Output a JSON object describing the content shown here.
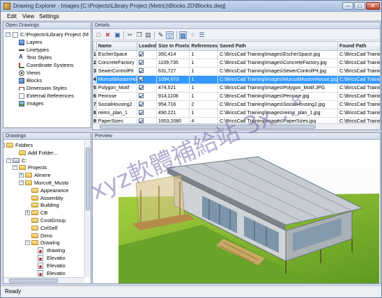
{
  "window": {
    "title": "Drawing Explorer - Images [C:\\Projects\\Library Project (Metric)\\Blocks 2D\\Blocks.dwg]",
    "buttons": {
      "minimize": "–",
      "maximize": "□",
      "close": "✕"
    }
  },
  "menu": {
    "edit": "Edit",
    "view": "View",
    "settings": "Settings"
  },
  "open_drawings": {
    "title": "Open Drawings",
    "root": "C:\\Projects\\Library Project (M",
    "items": [
      {
        "label": "Layers",
        "icon": "layers-icon"
      },
      {
        "label": "Linetypes",
        "icon": "linetypes-icon"
      },
      {
        "label": "Text Styles",
        "icon": "text-styles-icon"
      },
      {
        "label": "Coordinate Systems",
        "icon": "coordinate-systems-icon"
      },
      {
        "label": "Views",
        "icon": "views-icon"
      },
      {
        "label": "Blocks",
        "icon": "blocks-icon"
      },
      {
        "label": "Dimension Styles",
        "icon": "dimension-styles-icon"
      },
      {
        "label": "External References",
        "icon": "external-references-icon"
      },
      {
        "label": "Images",
        "icon": "images-icon"
      }
    ]
  },
  "details": {
    "title": "Details",
    "toolbar": [
      "new-icon",
      "delete-icon",
      "attach-icon",
      "cut-icon",
      "copy-icon",
      "paste-icon",
      "edit-icon",
      "filter-icon",
      "table-view-icon",
      "icon-view-icon",
      "tree-view-icon"
    ],
    "columns": [
      "",
      "Name",
      "Loaded",
      "Size In Pixels",
      "References",
      "Saved Path",
      "Found Path"
    ],
    "rows": [
      {
        "n": "1",
        "name": "EscherSpace",
        "size": "350,414",
        "refs": "1",
        "saved": "C:\\BricsCad Training\\Images\\EscherSpace.jpg",
        "found": "C:\\BricsCad Trainin"
      },
      {
        "n": "2",
        "name": "ConcreteFactory",
        "size": "1109,735",
        "refs": "1",
        "saved": "C:\\BricsCad Training\\Images\\ConcreteFactory.jpg",
        "found": "C:\\BricsCad Trainin"
      },
      {
        "n": "3",
        "name": "SewerControlPit",
        "size": "631,727",
        "refs": "1",
        "saved": "C:\\BricsCad Training\\Images\\SewerControlPit.jpg",
        "found": "C:\\BricsCad Trainin"
      },
      {
        "n": "4",
        "name": "MurcuttMustonHo",
        "size": "1094,673",
        "refs": "1",
        "saved": "C:\\BricsCad Training\\Images\\MurcuttMustonHouse.jpg",
        "found": "C:\\BricsCad Trainin"
      },
      {
        "n": "5",
        "name": "Polygon_Motif",
        "size": "474,521",
        "refs": "1",
        "saved": "C:\\BricsCad Training\\Images\\Polygon_Motif.JPG",
        "found": "C:\\BricsCad Trainin"
      },
      {
        "n": "6",
        "name": "Penrose",
        "size": "914,1108",
        "refs": "1",
        "saved": "C:\\BricsCad Training\\Images\\Penrose.jpg",
        "found": "C:\\BricsCad Trainin"
      },
      {
        "n": "7",
        "name": "SocialHousing2",
        "size": "954,716",
        "refs": "2",
        "saved": "C:\\BricsCad Training\\Images\\SocialHousing2.jpg",
        "found": "C:\\BricsCad Trainin"
      },
      {
        "n": "8",
        "name": "reims_plan_1",
        "size": "490,221",
        "refs": "1",
        "saved": "C:\\BricsCad Training\\Images\\reims_plan_1.jpg",
        "found": "C:\\BricsCad Trainin"
      },
      {
        "n": "9",
        "name": "PaperSizes",
        "size": "1653,2080",
        "refs": "4",
        "saved": "C:\\BricsCad Training\\Images\\PaperSizes.jpg",
        "found": "C:\\BricsCad Trainin"
      }
    ],
    "selected_row": 3
  },
  "drawings": {
    "title": "Drawings",
    "items": [
      {
        "label": "Folders",
        "kind": "folder",
        "expander": "−"
      },
      {
        "label": "Add Folder...",
        "kind": "folder",
        "expander": ""
      },
      {
        "label": "C:",
        "kind": "drive",
        "expander": "−"
      },
      {
        "label": "Projects",
        "kind": "folder",
        "expander": "−"
      },
      {
        "label": "Almere",
        "kind": "folder",
        "expander": "+"
      },
      {
        "label": "Murcutt_Musto",
        "kind": "folder",
        "expander": "−"
      },
      {
        "label": "Appearance",
        "kind": "folder",
        "expander": ""
      },
      {
        "label": "Assembly",
        "kind": "folder",
        "expander": ""
      },
      {
        "label": "Building",
        "kind": "folder",
        "expander": ""
      },
      {
        "label": "CB",
        "kind": "folder",
        "expander": "+"
      },
      {
        "label": "CostGroup",
        "kind": "folder",
        "expander": ""
      },
      {
        "label": "CtrlSelf",
        "kind": "folder",
        "expander": ""
      },
      {
        "label": "Dims",
        "kind": "folder",
        "expander": ""
      },
      {
        "label": "Drawing",
        "kind": "folder",
        "expander": "−"
      },
      {
        "label": "drawing",
        "kind": "dwg",
        "expander": ""
      },
      {
        "label": "Elevatio",
        "kind": "dwg",
        "expander": ""
      },
      {
        "label": "Elevatio",
        "kind": "dwg",
        "expander": ""
      },
      {
        "label": "Elevatio",
        "kind": "dwg",
        "expander": ""
      }
    ]
  },
  "preview": {
    "title": "Preview"
  },
  "status": {
    "text": "Ready"
  },
  "watermark": "xyz軟體補給站 3x…⁸"
}
